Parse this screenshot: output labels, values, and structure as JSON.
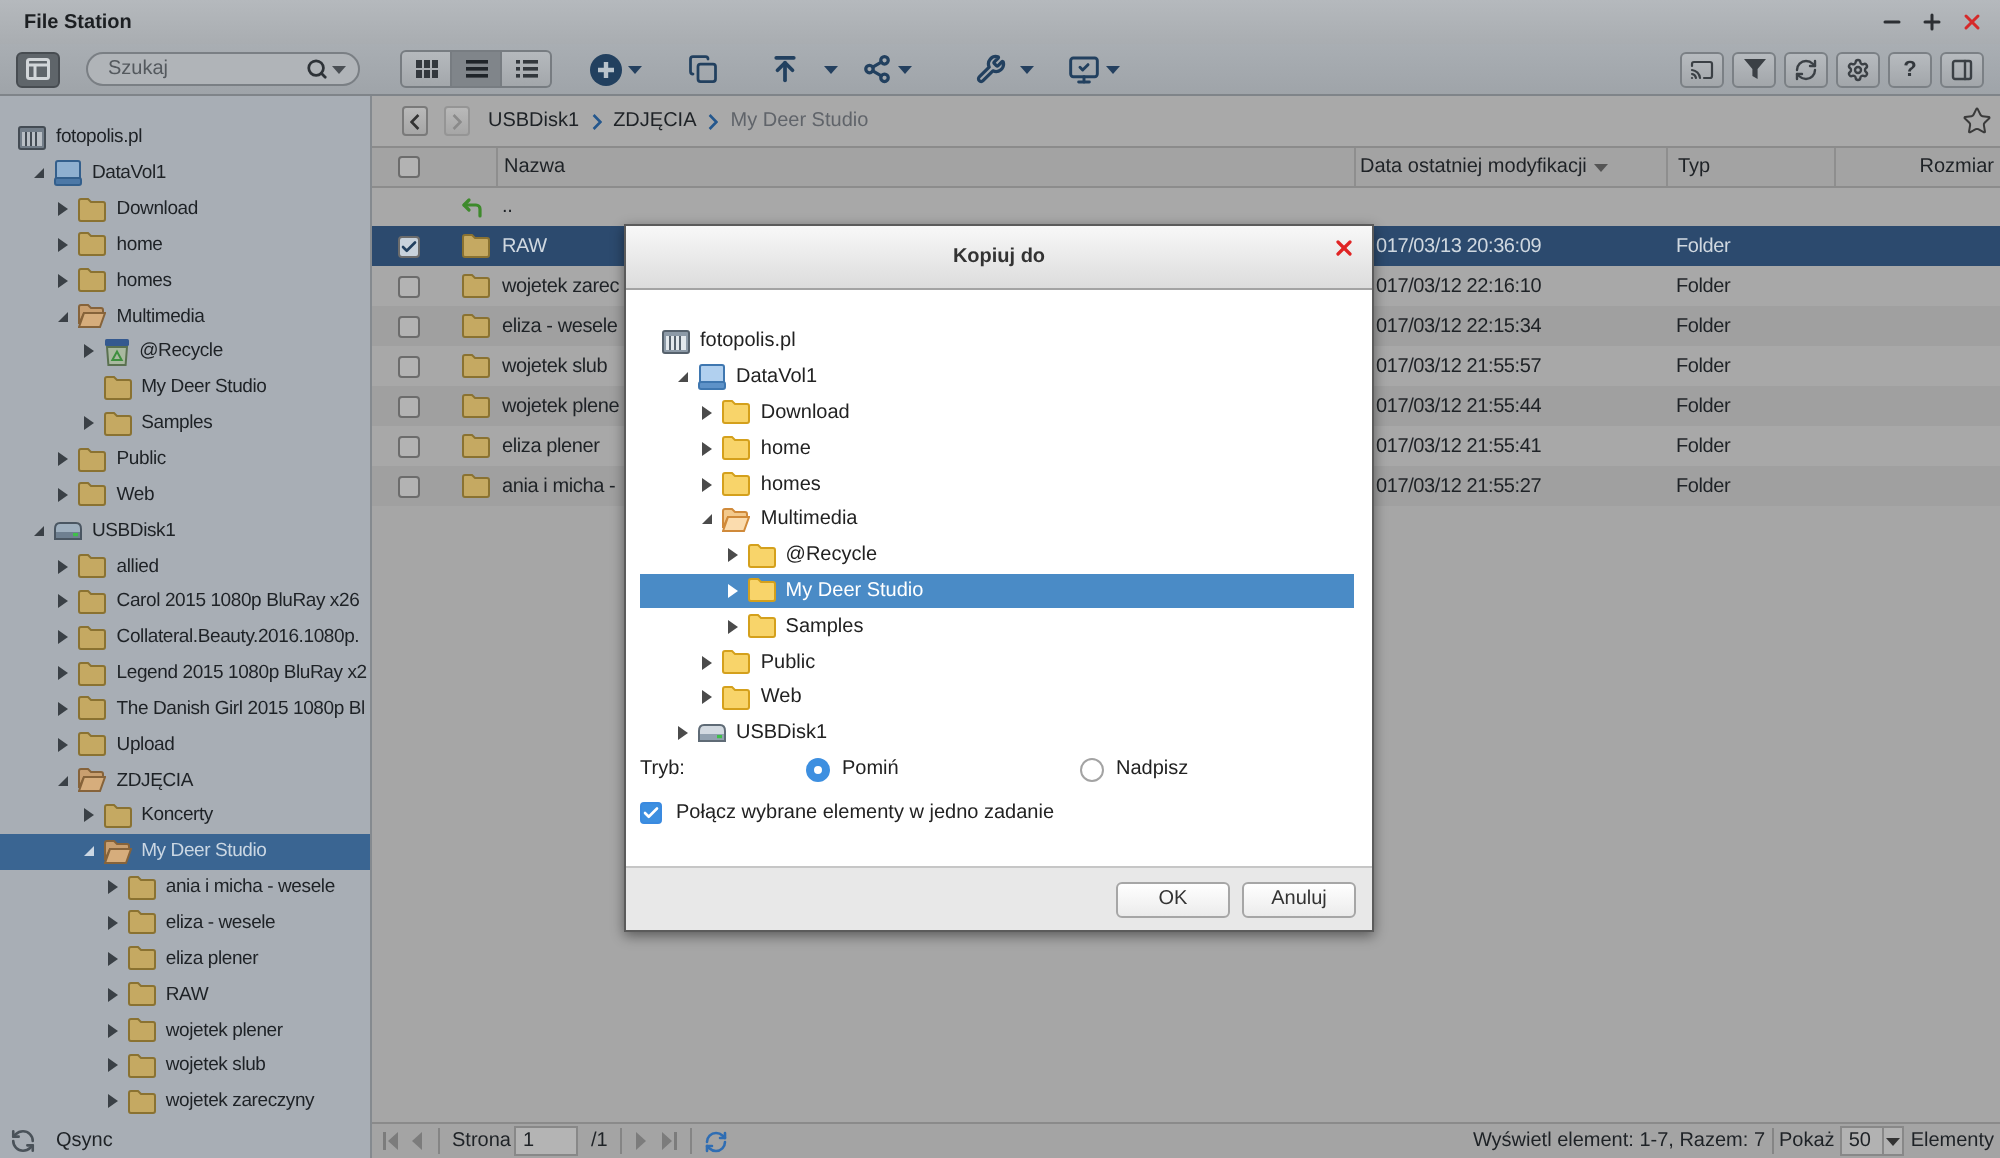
{
  "window": {
    "title": "File Station"
  },
  "toolbar": {
    "search": {
      "placeholder": "Szukaj"
    },
    "view_modes": [
      {
        "kind": "thumbnails",
        "selected": false
      },
      {
        "kind": "list",
        "selected": true
      },
      {
        "kind": "details",
        "selected": false
      }
    ],
    "help_label": "?"
  },
  "sidebar": {
    "root": {
      "label": "fotopolis.pl",
      "kind": "server",
      "children": [
        {
          "label": "DataVol1",
          "kind": "volume",
          "has_children": true,
          "expanded": true,
          "selected": false,
          "children": [
            {
              "label": "Download",
              "kind": "folder",
              "has_children": true,
              "expanded": false,
              "selected": false
            },
            {
              "label": "home",
              "kind": "folder",
              "has_children": true,
              "expanded": false,
              "selected": false
            },
            {
              "label": "homes",
              "kind": "folder",
              "has_children": true,
              "expanded": false,
              "selected": false
            },
            {
              "label": "Multimedia",
              "kind": "folder",
              "has_children": true,
              "expanded": true,
              "selected": false,
              "children": [
                {
                  "label": "@Recycle",
                  "kind": "recycle",
                  "has_children": true,
                  "expanded": false,
                  "selected": false
                },
                {
                  "label": "My Deer Studio",
                  "kind": "folder",
                  "has_children": false,
                  "expanded": false,
                  "selected": false
                },
                {
                  "label": "Samples",
                  "kind": "folder",
                  "has_children": true,
                  "expanded": false,
                  "selected": false
                }
              ]
            },
            {
              "label": "Public",
              "kind": "folder",
              "has_children": true,
              "expanded": false,
              "selected": false
            },
            {
              "label": "Web",
              "kind": "folder",
              "has_children": true,
              "expanded": false,
              "selected": false
            }
          ]
        },
        {
          "label": "USBDisk1",
          "kind": "usb",
          "has_children": true,
          "expanded": true,
          "selected": false,
          "children": [
            {
              "label": "allied",
              "kind": "folder",
              "has_children": true,
              "expanded": false,
              "selected": false
            },
            {
              "label": "Carol 2015 1080p BluRay x26",
              "kind": "folder",
              "has_children": true,
              "expanded": false,
              "selected": false
            },
            {
              "label": "Collateral.Beauty.2016.1080p.",
              "kind": "folder",
              "has_children": true,
              "expanded": false,
              "selected": false
            },
            {
              "label": "Legend 2015 1080p BluRay x2",
              "kind": "folder",
              "has_children": true,
              "expanded": false,
              "selected": false
            },
            {
              "label": "The Danish Girl 2015 1080p Bl",
              "kind": "folder",
              "has_children": true,
              "expanded": false,
              "selected": false
            },
            {
              "label": "Upload",
              "kind": "folder",
              "has_children": true,
              "expanded": false,
              "selected": false
            },
            {
              "label": "ZDJĘCIA",
              "kind": "folder",
              "has_children": true,
              "expanded": true,
              "selected": false,
              "children": [
                {
                  "label": "Koncerty",
                  "kind": "folder",
                  "has_children": true,
                  "expanded": false,
                  "selected": false
                },
                {
                  "label": "My Deer Studio",
                  "kind": "folder",
                  "has_children": true,
                  "expanded": true,
                  "selected": true,
                  "children": [
                    {
                      "label": "ania i micha - wesele",
                      "kind": "folder",
                      "has_children": true,
                      "expanded": false,
                      "selected": false
                    },
                    {
                      "label": "eliza - wesele",
                      "kind": "folder",
                      "has_children": true,
                      "expanded": false,
                      "selected": false
                    },
                    {
                      "label": "eliza plener",
                      "kind": "folder",
                      "has_children": true,
                      "expanded": false,
                      "selected": false
                    },
                    {
                      "label": "RAW",
                      "kind": "folder",
                      "has_children": true,
                      "expanded": false,
                      "selected": false
                    },
                    {
                      "label": "wojetek plener",
                      "kind": "folder",
                      "has_children": true,
                      "expanded": false,
                      "selected": false
                    },
                    {
                      "label": "wojetek slub",
                      "kind": "folder",
                      "has_children": true,
                      "expanded": false,
                      "selected": false
                    },
                    {
                      "label": "wojetek zareczyny",
                      "kind": "folder",
                      "has_children": true,
                      "expanded": false,
                      "selected": false
                    }
                  ]
                }
              ]
            }
          ]
        }
      ]
    },
    "footer": {
      "label": "Qsync"
    }
  },
  "breadcrumb": {
    "back": {
      "disabled": false
    },
    "forward": {
      "disabled": true
    },
    "items": [
      "USBDisk1",
      "ZDJĘCIA",
      "My Deer Studio"
    ]
  },
  "table": {
    "columns": [
      {
        "label": "Nazwa",
        "sorted": false
      },
      {
        "label": "Data ostatniej modyfikacji",
        "sorted": true
      },
      {
        "label": "Typ",
        "sorted": false
      },
      {
        "label": "Rozmiar",
        "sorted": false
      }
    ],
    "all_checked": false,
    "parent_label": "..",
    "rows": [
      {
        "name": "RAW",
        "modified": "017/03/13 20:36:09",
        "type": "Folder",
        "selected": true
      },
      {
        "name": "wojetek zarec",
        "modified": "017/03/12 22:16:10",
        "type": "Folder",
        "selected": false
      },
      {
        "name": "eliza - wesele",
        "modified": "017/03/12 22:15:34",
        "type": "Folder",
        "selected": false
      },
      {
        "name": "wojetek slub",
        "modified": "017/03/12 21:55:57",
        "type": "Folder",
        "selected": false
      },
      {
        "name": "wojetek plene",
        "modified": "017/03/12 21:55:44",
        "type": "Folder",
        "selected": false
      },
      {
        "name": "eliza plener",
        "modified": "017/03/12 21:55:41",
        "type": "Folder",
        "selected": false
      },
      {
        "name": "ania i micha -",
        "modified": "017/03/12 21:55:27",
        "type": "Folder",
        "selected": false
      }
    ]
  },
  "status_bar": {
    "pager": {
      "first": {
        "disabled": true
      },
      "previous": {
        "disabled": true
      },
      "next": {
        "disabled": true
      },
      "last": {
        "disabled": true
      }
    },
    "page_label": "Strona",
    "page_value": "1",
    "page_total": "/1",
    "summary": "Wyświetl element: 1-7, Razem: 7",
    "show_label": "Pokaż",
    "page_size": "50",
    "items_label": "Elementy"
  },
  "dialog": {
    "title": "Kopiuj do",
    "root": {
      "label": "fotopolis.pl",
      "kind": "server",
      "children": [
        {
          "label": "DataVol1",
          "kind": "volume",
          "has_children": true,
          "expanded": true,
          "selected": false,
          "children": [
            {
              "label": "Download",
              "kind": "folder",
              "has_children": true,
              "expanded": false,
              "selected": false
            },
            {
              "label": "home",
              "kind": "folder",
              "has_children": true,
              "expanded": false,
              "selected": false
            },
            {
              "label": "homes",
              "kind": "folder",
              "has_children": true,
              "expanded": false,
              "selected": false
            },
            {
              "label": "Multimedia",
              "kind": "folder",
              "has_children": true,
              "expanded": true,
              "selected": false,
              "children": [
                {
                  "label": "@Recycle",
                  "kind": "folder",
                  "has_children": true,
                  "expanded": false,
                  "selected": false
                },
                {
                  "label": "My Deer Studio",
                  "kind": "folder",
                  "has_children": true,
                  "expanded": false,
                  "selected": true
                },
                {
                  "label": "Samples",
                  "kind": "folder",
                  "has_children": true,
                  "expanded": false,
                  "selected": false
                }
              ]
            },
            {
              "label": "Public",
              "kind": "folder",
              "has_children": true,
              "expanded": false,
              "selected": false
            },
            {
              "label": "Web",
              "kind": "folder",
              "has_children": true,
              "expanded": false,
              "selected": false
            }
          ]
        },
        {
          "label": "USBDisk1",
          "kind": "usb",
          "has_children": true,
          "expanded": false,
          "selected": false
        }
      ]
    },
    "mode_label": "Tryb:",
    "modes": [
      {
        "label": "Pomiń",
        "selected": true
      },
      {
        "label": "Nadpisz",
        "selected": false
      }
    ],
    "merge_option": {
      "label": "Połącz wybrane elementy w jedno zadanie",
      "checked": true
    },
    "buttons": [
      {
        "label": "OK"
      },
      {
        "label": "Anuluj"
      }
    ]
  }
}
